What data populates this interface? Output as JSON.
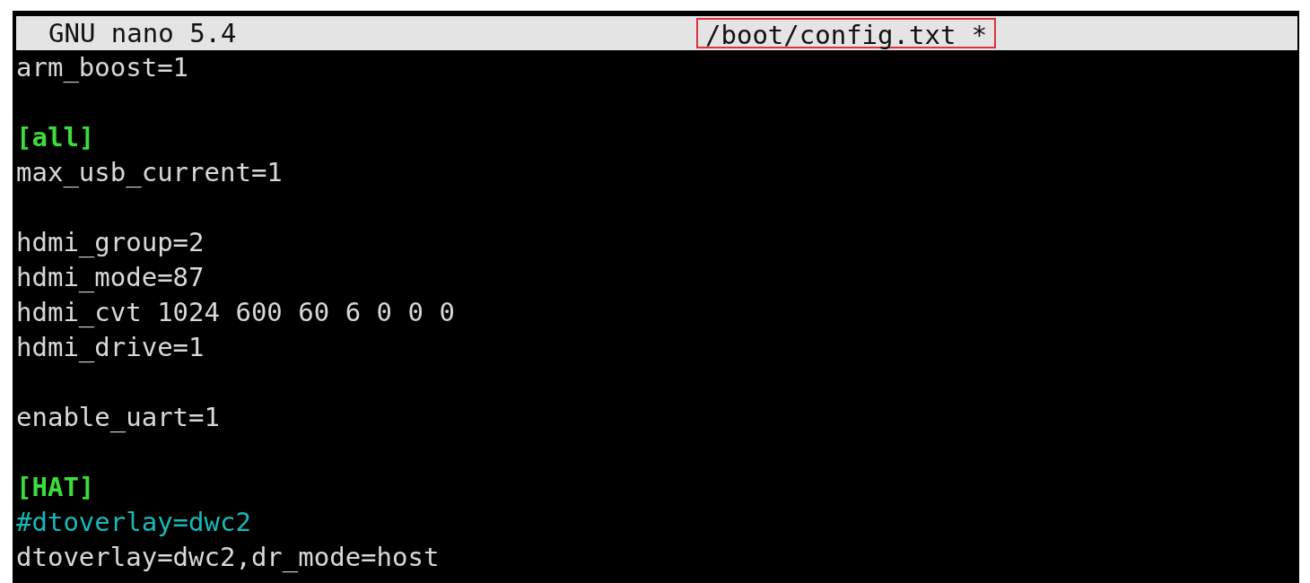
{
  "title_bar": {
    "version": "GNU nano 5.4",
    "filename": "/boot/config.txt *",
    "filename_highlighted": true
  },
  "lines": [
    {
      "kind": "plain",
      "text": "arm_boost=1"
    },
    {
      "kind": "blank"
    },
    {
      "kind": "section",
      "text": "[all]"
    },
    {
      "kind": "plain",
      "text": "max_usb_current=1"
    },
    {
      "kind": "blank"
    },
    {
      "kind": "plain",
      "text": "hdmi_group=2"
    },
    {
      "kind": "plain",
      "text": "hdmi_mode=87"
    },
    {
      "kind": "plain",
      "text": "hdmi_cvt 1024 600 60 6 0 0 0"
    },
    {
      "kind": "plain",
      "text": "hdmi_drive=1"
    },
    {
      "kind": "blank"
    },
    {
      "kind": "plain",
      "text": "enable_uart=1"
    },
    {
      "kind": "blank"
    },
    {
      "kind": "section",
      "text": "[HAT]"
    },
    {
      "kind": "comment",
      "text": "#dtoverlay=dwc2"
    },
    {
      "kind": "plain",
      "text": "dtoverlay=dwc2,dr_mode=host"
    }
  ]
}
